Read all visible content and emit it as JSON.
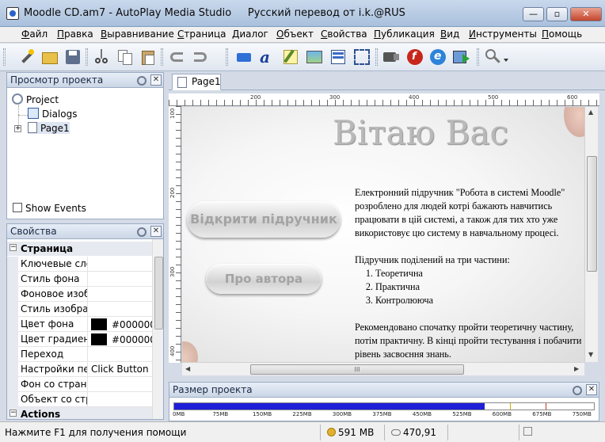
{
  "window": {
    "title": "Moodle CD.am7 - AutoPlay Media Studio",
    "subtitle": "Русский перевод от i.k.@RUS",
    "controls": {
      "minimize": "—",
      "maximize": "▫",
      "close": "✕"
    }
  },
  "menu": [
    "Файл",
    "Правка",
    "Выравнивание",
    "Страница",
    "Диалог",
    "Объект",
    "Свойства",
    "Публикация",
    "Вид",
    "Инструменты",
    "Помощь"
  ],
  "project_panel": {
    "title": "Просмотр проекта",
    "tree": [
      {
        "label": "Project",
        "level": 0
      },
      {
        "label": "Dialogs",
        "level": 1
      },
      {
        "label": "Page1",
        "level": 1
      }
    ],
    "show_events": "Show Events"
  },
  "properties_panel": {
    "title": "Свойства",
    "category": "Страница",
    "rows": [
      {
        "name": "Ключевые сло",
        "value": ""
      },
      {
        "name": "Стиль фона",
        "value": ""
      },
      {
        "name": "Фоновое изоб",
        "value": ""
      },
      {
        "name": "Стиль изображ",
        "value": ""
      },
      {
        "name": "Цвет фона",
        "value": "#000000"
      },
      {
        "name": "Цвет градиента",
        "value": "#000000"
      },
      {
        "name": "Переход",
        "value": ""
      },
      {
        "name": "Настройки пер",
        "value": "Click Button"
      },
      {
        "name": "Фон со страни",
        "value": ""
      },
      {
        "name": "Объект со стра",
        "value": ""
      }
    ],
    "category2": "Actions"
  },
  "document": {
    "tab": "Page1",
    "ruler_h": [
      "200",
      "300",
      "400",
      "500",
      "600"
    ],
    "ruler_v": [
      "100",
      "200",
      "300",
      "400"
    ],
    "hscroll_grip": "III",
    "page": {
      "heading": "Вітаю Вас",
      "button_open": "Відкрити підручник",
      "button_author": "Про автора",
      "intro_lines": [
        "Електронний підручник \"Робота в системі Moodle\"",
        "розроблено для людей котрі бажають навчитись",
        "працювати в цій системі, а також для тих хто уже",
        "використовує цю систему в навчальному процесі."
      ],
      "parts_intro": "Підручник поділений на три частини:",
      "parts": [
        "Теоретична",
        "Практична",
        "Контролююча"
      ],
      "recommend_lines": [
        "Рекомендовано спочатку пройти теоретичну частину,",
        "потім практичну. В кінці пройти тестування і побачити",
        "рівень засвоєння знань."
      ]
    }
  },
  "size_panel": {
    "title": "Размер проекта",
    "used_mb": 591,
    "scale_max_mb": 800,
    "scale": [
      "0MB",
      "75MB",
      "150MB",
      "225MB",
      "300MB",
      "375MB",
      "450MB",
      "525MB",
      "600MB",
      "675MB",
      "750MB"
    ]
  },
  "status": {
    "hint": "Нажмите F1 для получения помощи",
    "size": "591 MB",
    "coords": "470,91"
  },
  "colors": {
    "accent": "#1f1fd8",
    "title_bar": "#b9cce6"
  },
  "toolbar_icons": [
    "new-project-wand-icon",
    "open-folder-icon",
    "save-icon",
    "cut-icon",
    "copy-icon",
    "paste-icon",
    "undo-icon",
    "redo-icon",
    "button-object-icon",
    "label-object-icon",
    "paragraph-object-icon",
    "image-object-icon",
    "listbox-object-icon",
    "input-object-icon",
    "video-object-icon",
    "flash-object-icon",
    "web-object-icon",
    "slideshow-object-icon",
    "zoom-icon"
  ]
}
